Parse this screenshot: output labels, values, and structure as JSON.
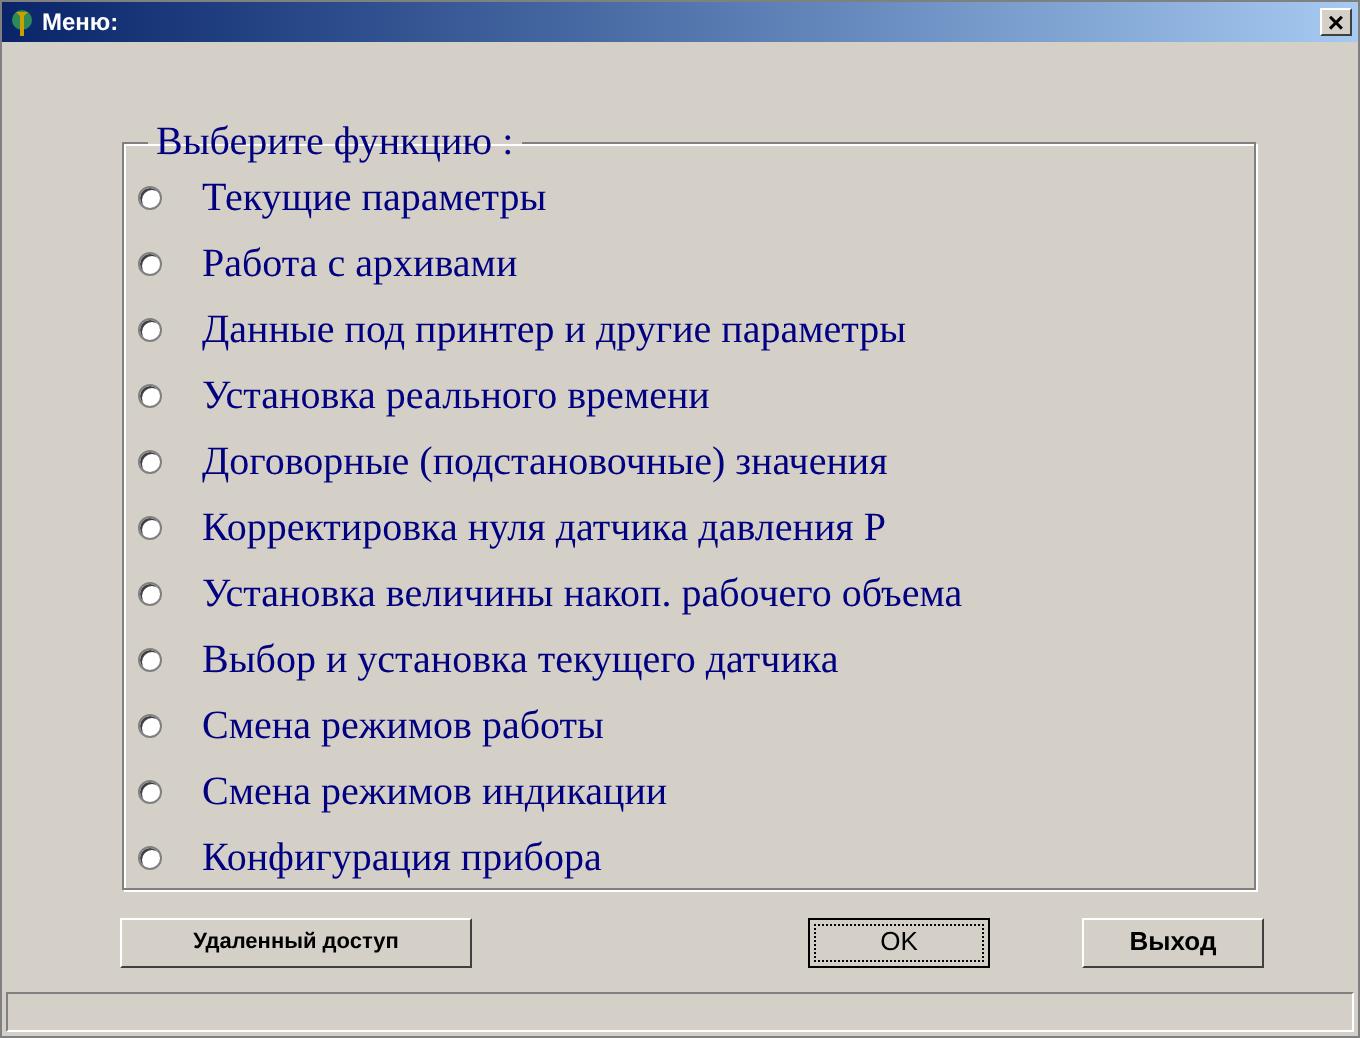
{
  "window": {
    "title": "Меню:",
    "close": "×"
  },
  "group": {
    "legend": "Выберите функцию :"
  },
  "options": [
    {
      "label": "Текущие параметры",
      "selected": false
    },
    {
      "label": "Работа с архивами",
      "selected": false
    },
    {
      "label": "Данные под принтер и другие параметры",
      "selected": false
    },
    {
      "label": "Установка реального времени",
      "selected": false
    },
    {
      "label": "Договорные (подстановочные) значения",
      "selected": false
    },
    {
      "label": "Корректировка нуля датчика давления P",
      "selected": false
    },
    {
      "label": "Установка величины накоп. рабочего объема",
      "selected": false
    },
    {
      "label": "Выбор и установка текущего датчика",
      "selected": false
    },
    {
      "label": "Смена режимов работы",
      "selected": false
    },
    {
      "label": "Смена режимов индикации",
      "selected": false
    },
    {
      "label": "Конфигурация прибора",
      "selected": false
    }
  ],
  "buttons": [
    {
      "label": "Удаленный доступ",
      "focused": false
    },
    {
      "label": "OK",
      "focused": true
    },
    {
      "label": "Выход",
      "focused": false
    }
  ]
}
